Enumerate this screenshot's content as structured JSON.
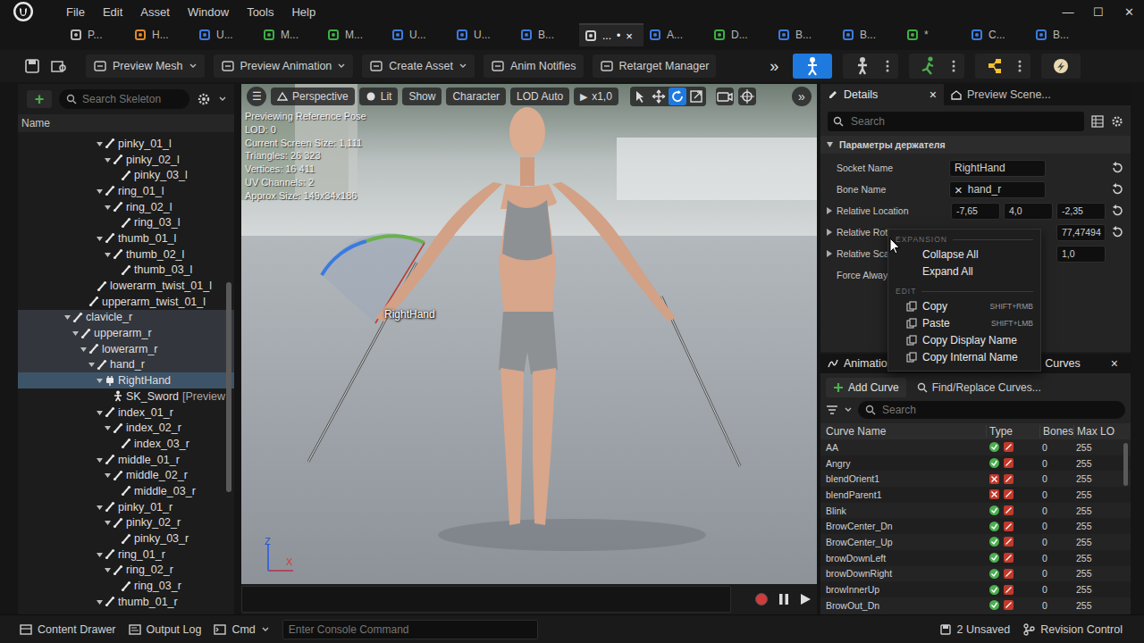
{
  "menu_bar": [
    "File",
    "Edit",
    "Asset",
    "Window",
    "Tools",
    "Help"
  ],
  "window_controls": [
    "—",
    "☐",
    "✕"
  ],
  "document_tabs": [
    {
      "label": "P...",
      "selected": false,
      "color": "#b8b8b8"
    },
    {
      "label": "H...",
      "selected": false,
      "color": "#e08a2a"
    },
    {
      "label": "U...",
      "selected": false,
      "color": "#3d7be0"
    },
    {
      "label": "M...",
      "selected": false,
      "color": "#3cb043"
    },
    {
      "label": "M...",
      "selected": false,
      "color": "#3cb043"
    },
    {
      "label": "U...",
      "selected": false,
      "color": "#3d7be0"
    },
    {
      "label": "U...",
      "selected": false,
      "color": "#3d7be0"
    },
    {
      "label": "B...",
      "selected": false,
      "color": "#3d7be0"
    },
    {
      "label": "...",
      "selected": true,
      "color": "#d0d0d0",
      "modified": "•",
      "close": "×"
    },
    {
      "label": "A...",
      "selected": false,
      "color": "#3d7be0"
    },
    {
      "label": "D...",
      "selected": false,
      "color": "#3cb043"
    },
    {
      "label": "B...",
      "selected": false,
      "color": "#3d7be0"
    },
    {
      "label": "B...",
      "selected": false,
      "color": "#3d7be0"
    },
    {
      "label": "*",
      "selected": false,
      "color": "#3cb043"
    },
    {
      "label": "C...",
      "selected": false,
      "color": "#3d7be0"
    },
    {
      "label": "B...",
      "selected": false,
      "color": "#3d7be0"
    }
  ],
  "toolbar": {
    "buttons": [
      {
        "label": "Preview Mesh",
        "dropdown": true
      },
      {
        "label": "Preview Animation",
        "dropdown": true
      },
      {
        "label": "Create Asset",
        "dropdown": true
      },
      {
        "label": "Anim Notifies",
        "dropdown": false
      },
      {
        "label": "Retarget Manager",
        "dropdown": false
      }
    ],
    "overflow": "»",
    "modes": [
      {
        "kind": "skeleton",
        "selected": true
      },
      {
        "kind": "mesh",
        "selected": false
      },
      {
        "kind": "animation",
        "selected": false
      },
      {
        "kind": "blueprint",
        "selected": false
      },
      {
        "kind": "physics",
        "selected": false
      }
    ]
  },
  "skeleton_tree": {
    "add": "+",
    "search_placeholder": "Search Skeleton",
    "column": "Name",
    "items": [
      {
        "label": "pinky_01_l",
        "depth": 4,
        "kind": "bone",
        "expandable": true,
        "selected": false,
        "in_path": false
      },
      {
        "label": "pinky_02_l",
        "depth": 5,
        "kind": "bone",
        "expandable": true,
        "selected": false,
        "in_path": false
      },
      {
        "label": "pinky_03_l",
        "depth": 6,
        "kind": "bone",
        "expandable": false,
        "selected": false,
        "in_path": false
      },
      {
        "label": "ring_01_l",
        "depth": 4,
        "kind": "bone",
        "expandable": true,
        "selected": false,
        "in_path": false
      },
      {
        "label": "ring_02_l",
        "depth": 5,
        "kind": "bone",
        "expandable": true,
        "selected": false,
        "in_path": false
      },
      {
        "label": "ring_03_l",
        "depth": 6,
        "kind": "bone",
        "expandable": false,
        "selected": false,
        "in_path": false
      },
      {
        "label": "thumb_01_l",
        "depth": 4,
        "kind": "bone",
        "expandable": true,
        "selected": false,
        "in_path": false
      },
      {
        "label": "thumb_02_l",
        "depth": 5,
        "kind": "bone",
        "expandable": true,
        "selected": false,
        "in_path": false
      },
      {
        "label": "thumb_03_l",
        "depth": 6,
        "kind": "bone",
        "expandable": false,
        "selected": false,
        "in_path": false
      },
      {
        "label": "lowerarm_twist_01_l",
        "depth": 3,
        "kind": "bone",
        "expandable": false,
        "selected": false,
        "in_path": false
      },
      {
        "label": "upperarm_twist_01_l",
        "depth": 2,
        "kind": "bone",
        "expandable": false,
        "selected": false,
        "in_path": false
      },
      {
        "label": "clavicle_r",
        "depth": 0,
        "kind": "bone",
        "expandable": true,
        "selected": false,
        "in_path": true
      },
      {
        "label": "upperarm_r",
        "depth": 1,
        "kind": "bone",
        "expandable": true,
        "selected": false,
        "in_path": true
      },
      {
        "label": "lowerarm_r",
        "depth": 2,
        "kind": "bone",
        "expandable": true,
        "selected": false,
        "in_path": true
      },
      {
        "label": "hand_r",
        "depth": 3,
        "kind": "bone",
        "expandable": true,
        "selected": false,
        "in_path": true
      },
      {
        "label": "RightHand",
        "depth": 4,
        "kind": "socket",
        "expandable": true,
        "selected": true,
        "in_path": false
      },
      {
        "label": "SK_Sword",
        "note": "[Preview",
        "depth": 5,
        "kind": "mesh",
        "expandable": false,
        "selected": false,
        "in_path": false
      },
      {
        "label": "index_01_r",
        "depth": 4,
        "kind": "bone",
        "expandable": true,
        "selected": false,
        "in_path": false
      },
      {
        "label": "index_02_r",
        "depth": 5,
        "kind": "bone",
        "expandable": true,
        "selected": false,
        "in_path": false
      },
      {
        "label": "index_03_r",
        "depth": 6,
        "kind": "bone",
        "expandable": false,
        "selected": false,
        "in_path": false
      },
      {
        "label": "middle_01_r",
        "depth": 4,
        "kind": "bone",
        "expandable": true,
        "selected": false,
        "in_path": false
      },
      {
        "label": "middle_02_r",
        "depth": 5,
        "kind": "bone",
        "expandable": true,
        "selected": false,
        "in_path": false
      },
      {
        "label": "middle_03_r",
        "depth": 6,
        "kind": "bone",
        "expandable": false,
        "selected": false,
        "in_path": false
      },
      {
        "label": "pinky_01_r",
        "depth": 4,
        "kind": "bone",
        "expandable": true,
        "selected": false,
        "in_path": false
      },
      {
        "label": "pinky_02_r",
        "depth": 5,
        "kind": "bone",
        "expandable": true,
        "selected": false,
        "in_path": false
      },
      {
        "label": "pinky_03_r",
        "depth": 6,
        "kind": "bone",
        "expandable": false,
        "selected": false,
        "in_path": false
      },
      {
        "label": "ring_01_r",
        "depth": 4,
        "kind": "bone",
        "expandable": true,
        "selected": false,
        "in_path": false
      },
      {
        "label": "ring_02_r",
        "depth": 5,
        "kind": "bone",
        "expandable": true,
        "selected": false,
        "in_path": false
      },
      {
        "label": "ring_03_r",
        "depth": 6,
        "kind": "bone",
        "expandable": false,
        "selected": false,
        "in_path": false
      },
      {
        "label": "thumb_01_r",
        "depth": 4,
        "kind": "bone",
        "expandable": true,
        "selected": false,
        "in_path": false
      }
    ]
  },
  "viewport": {
    "toolbar": {
      "menu": "☰",
      "view": "Perspective",
      "lit": "Lit",
      "show": "Show",
      "character": "Character",
      "lod": "LOD Auto",
      "speed_icon": "▶",
      "speed": "x1,0",
      "overflow": "»",
      "tools": [
        {
          "kind": "select",
          "selected": false
        },
        {
          "kind": "translate",
          "selected": false
        },
        {
          "kind": "rotate",
          "selected": true
        },
        {
          "kind": "scale",
          "selected": false
        }
      ]
    },
    "stats": [
      "Previewing Reference Pose",
      "LOD: 0",
      "Current Screen Size: 1,111",
      "Triangles: 26 323",
      "Vertices: 16 411",
      "UV Channels: 2",
      "Approx Size: 149x34x186"
    ],
    "socket_label": "RightHand",
    "axes": [
      "Z",
      "X"
    ]
  },
  "details": {
    "tabs": [
      {
        "label": "Details",
        "selected": true,
        "close": "×"
      },
      {
        "label": "Preview Scene...",
        "selected": false
      }
    ],
    "search_placeholder": "Search",
    "section": "Параметры держателя",
    "rows": [
      {
        "label": "Socket Name",
        "kind": "text",
        "value": "RightHand",
        "expandable": false,
        "reset": true
      },
      {
        "label": "Bone Name",
        "kind": "bone",
        "value": "hand_r",
        "clear": "×",
        "expandable": false,
        "reset": true
      },
      {
        "label": "Relative Location",
        "kind": "vector",
        "values": [
          "-7,65",
          "4,0",
          "-2,35"
        ],
        "expandable": true,
        "reset": true
      },
      {
        "label": "Relative Rota",
        "kind": "vector",
        "values": [
          "77,47494"
        ],
        "expandable": true,
        "reset": true
      },
      {
        "label": "Relative Scal",
        "kind": "vector",
        "values": [
          "1,0"
        ],
        "expandable": true,
        "reset": false
      },
      {
        "label": "Force Always",
        "kind": "label",
        "expandable": false,
        "reset": false
      }
    ]
  },
  "context_menu": {
    "sections": [
      {
        "title": "EXPANSION",
        "items": [
          {
            "label": "Collapse All",
            "icon": false
          },
          {
            "label": "Expand All",
            "icon": false
          }
        ]
      },
      {
        "title": "EDIT",
        "items": [
          {
            "label": "Copy",
            "shortcut": "SHIFT+RMB",
            "icon": true
          },
          {
            "label": "Paste",
            "shortcut": "SHIFT+LMB",
            "icon": true
          },
          {
            "label": "Copy Display Name",
            "icon": true
          },
          {
            "label": "Copy Internal Name",
            "icon": true
          }
        ]
      }
    ]
  },
  "curves_panel": {
    "tab_left": "Animatio",
    "tab_right": "Curves",
    "close": "×",
    "add": "Add Curve",
    "find_replace": "Find/Replace Curves...",
    "search_placeholder": "Search",
    "columns": [
      "Curve Name",
      "Type",
      "Bones",
      "Max LO"
    ],
    "rows": [
      {
        "name": "AA",
        "morph": true,
        "material": false,
        "bones": "0",
        "max_lod": "255"
      },
      {
        "name": "Angry",
        "morph": true,
        "material": false,
        "bones": "0",
        "max_lod": "255"
      },
      {
        "name": "blendOrient1",
        "morph": false,
        "material": false,
        "bones": "0",
        "max_lod": "255"
      },
      {
        "name": "blendParent1",
        "morph": false,
        "material": false,
        "bones": "0",
        "max_lod": "255"
      },
      {
        "name": "Blink",
        "morph": true,
        "material": false,
        "bones": "0",
        "max_lod": "255"
      },
      {
        "name": "BrowCenter_Dn",
        "morph": true,
        "material": false,
        "bones": "0",
        "max_lod": "255"
      },
      {
        "name": "BrowCenter_Up",
        "morph": true,
        "material": false,
        "bones": "0",
        "max_lod": "255"
      },
      {
        "name": "browDownLeft",
        "morph": true,
        "material": false,
        "bones": "0",
        "max_lod": "255"
      },
      {
        "name": "browDownRight",
        "morph": true,
        "material": false,
        "bones": "0",
        "max_lod": "255"
      },
      {
        "name": "browInnerUp",
        "morph": true,
        "material": false,
        "bones": "0",
        "max_lod": "255"
      },
      {
        "name": "BrowOut_Dn",
        "morph": true,
        "material": false,
        "bones": "0",
        "max_lod": "255"
      }
    ]
  },
  "status_bar": {
    "content_drawer": "Content Drawer",
    "output_log": "Output Log",
    "cmd": "Cmd",
    "console_placeholder": "Enter Console Command",
    "unsaved": "2 Unsaved",
    "revision_control": "Revision Control"
  }
}
